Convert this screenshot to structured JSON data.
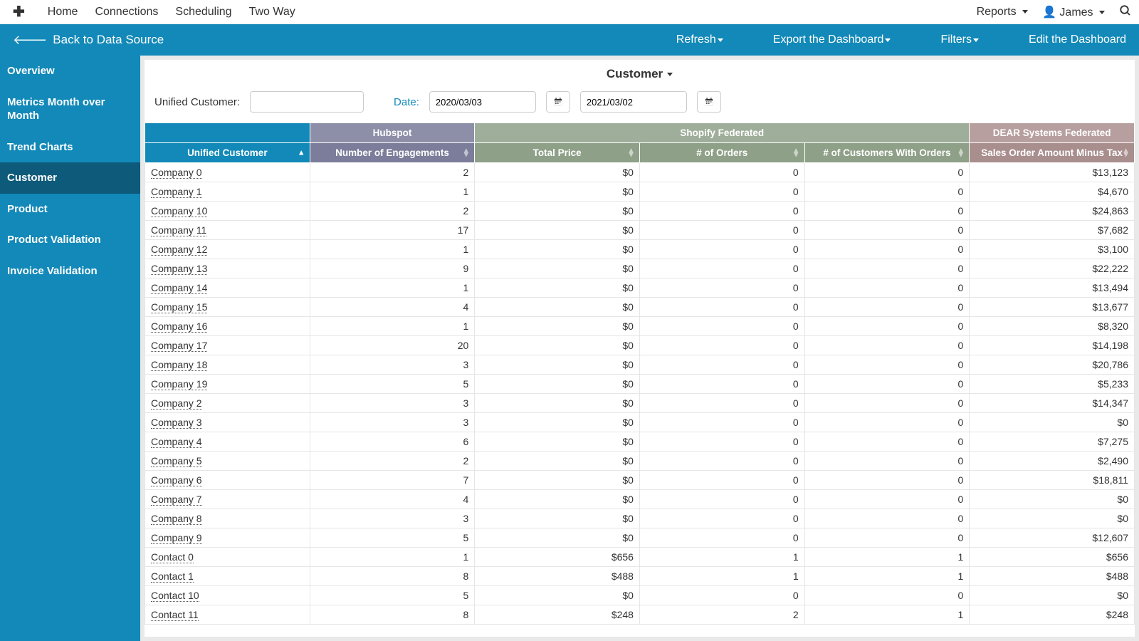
{
  "topnav": {
    "items": [
      "Home",
      "Connections",
      "Scheduling",
      "Two Way"
    ],
    "reports": "Reports",
    "user": "James"
  },
  "bluebar": {
    "back": "Back to Data Source",
    "refresh": "Refresh",
    "export": "Export the Dashboard",
    "filters": "Filters",
    "edit": "Edit the Dashboard"
  },
  "sidebar": {
    "items": [
      {
        "label": "Overview",
        "active": false
      },
      {
        "label": "Metrics Month over Month",
        "active": false
      },
      {
        "label": "Trend Charts",
        "active": false
      },
      {
        "label": "Customer",
        "active": true
      },
      {
        "label": "Product",
        "active": false
      },
      {
        "label": "Product Validation",
        "active": false
      },
      {
        "label": "Invoice Validation",
        "active": false
      }
    ]
  },
  "panel": {
    "title": "Customer",
    "filter_label": "Unified Customer:",
    "filter_value": "",
    "date_label": "Date:",
    "date_from": "2020/03/03",
    "date_to": "2021/03/02"
  },
  "table": {
    "group_headers": {
      "uc": "",
      "hubspot": "Hubspot",
      "shopify": "Shopify Federated",
      "dear": "DEAR Systems Federated"
    },
    "headers": {
      "uc": "Unified Customer",
      "engagements": "Number of Engagements",
      "total_price": "Total Price",
      "orders": "# of Orders",
      "customers_with_orders": "# of Customers With Orders",
      "sales_order": "Sales Order Amount Minus Tax"
    },
    "rows": [
      {
        "name": "Company 0",
        "eng": "2",
        "tp": "$0",
        "ord": "0",
        "cwo": "0",
        "so": "$13,123"
      },
      {
        "name": "Company 1",
        "eng": "1",
        "tp": "$0",
        "ord": "0",
        "cwo": "0",
        "so": "$4,670"
      },
      {
        "name": "Company 10",
        "eng": "2",
        "tp": "$0",
        "ord": "0",
        "cwo": "0",
        "so": "$24,863"
      },
      {
        "name": "Company 11",
        "eng": "17",
        "tp": "$0",
        "ord": "0",
        "cwo": "0",
        "so": "$7,682"
      },
      {
        "name": "Company 12",
        "eng": "1",
        "tp": "$0",
        "ord": "0",
        "cwo": "0",
        "so": "$3,100"
      },
      {
        "name": "Company 13",
        "eng": "9",
        "tp": "$0",
        "ord": "0",
        "cwo": "0",
        "so": "$22,222"
      },
      {
        "name": "Company 14",
        "eng": "1",
        "tp": "$0",
        "ord": "0",
        "cwo": "0",
        "so": "$13,494"
      },
      {
        "name": "Company 15",
        "eng": "4",
        "tp": "$0",
        "ord": "0",
        "cwo": "0",
        "so": "$13,677"
      },
      {
        "name": "Company 16",
        "eng": "1",
        "tp": "$0",
        "ord": "0",
        "cwo": "0",
        "so": "$8,320"
      },
      {
        "name": "Company 17",
        "eng": "20",
        "tp": "$0",
        "ord": "0",
        "cwo": "0",
        "so": "$14,198"
      },
      {
        "name": "Company 18",
        "eng": "3",
        "tp": "$0",
        "ord": "0",
        "cwo": "0",
        "so": "$20,786"
      },
      {
        "name": "Company 19",
        "eng": "5",
        "tp": "$0",
        "ord": "0",
        "cwo": "0",
        "so": "$5,233"
      },
      {
        "name": "Company 2",
        "eng": "3",
        "tp": "$0",
        "ord": "0",
        "cwo": "0",
        "so": "$14,347"
      },
      {
        "name": "Company 3",
        "eng": "3",
        "tp": "$0",
        "ord": "0",
        "cwo": "0",
        "so": "$0"
      },
      {
        "name": "Company 4",
        "eng": "6",
        "tp": "$0",
        "ord": "0",
        "cwo": "0",
        "so": "$7,275"
      },
      {
        "name": "Company 5",
        "eng": "2",
        "tp": "$0",
        "ord": "0",
        "cwo": "0",
        "so": "$2,490"
      },
      {
        "name": "Company 6",
        "eng": "7",
        "tp": "$0",
        "ord": "0",
        "cwo": "0",
        "so": "$18,811"
      },
      {
        "name": "Company 7",
        "eng": "4",
        "tp": "$0",
        "ord": "0",
        "cwo": "0",
        "so": "$0"
      },
      {
        "name": "Company 8",
        "eng": "3",
        "tp": "$0",
        "ord": "0",
        "cwo": "0",
        "so": "$0"
      },
      {
        "name": "Company 9",
        "eng": "5",
        "tp": "$0",
        "ord": "0",
        "cwo": "0",
        "so": "$12,607"
      },
      {
        "name": "Contact 0",
        "eng": "1",
        "tp": "$656",
        "ord": "1",
        "cwo": "1",
        "so": "$656"
      },
      {
        "name": "Contact 1",
        "eng": "8",
        "tp": "$488",
        "ord": "1",
        "cwo": "1",
        "so": "$488"
      },
      {
        "name": "Contact 10",
        "eng": "5",
        "tp": "$0",
        "ord": "0",
        "cwo": "0",
        "so": "$0"
      },
      {
        "name": "Contact 11",
        "eng": "8",
        "tp": "$248",
        "ord": "2",
        "cwo": "1",
        "so": "$248"
      }
    ]
  }
}
